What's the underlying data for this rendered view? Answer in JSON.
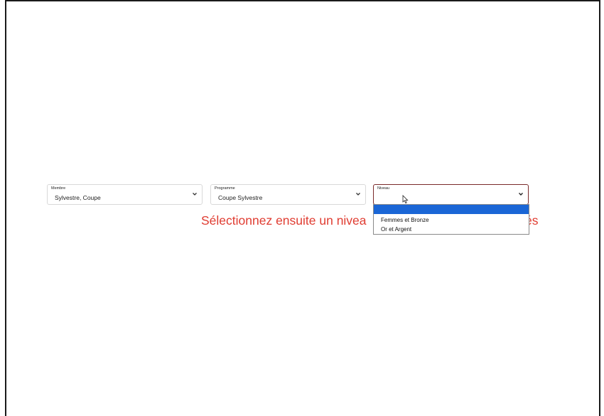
{
  "selects": [
    {
      "label": "Membre",
      "value": "Sylvestre, Coupe"
    },
    {
      "label": "Programme",
      "value": "Coupe Sylvestre"
    },
    {
      "label": "Niveau",
      "value": ""
    }
  ],
  "error_message": {
    "visible_start": "Sélectionnez ensuite un nivea",
    "visible_end": "és"
  },
  "dropdown_options": [
    "",
    "Femmes et Bronze",
    "Or et Argent"
  ],
  "colors": {
    "error": "#e03c31",
    "highlight": "#1a66d6",
    "focus_border": "#7a2a2a"
  }
}
